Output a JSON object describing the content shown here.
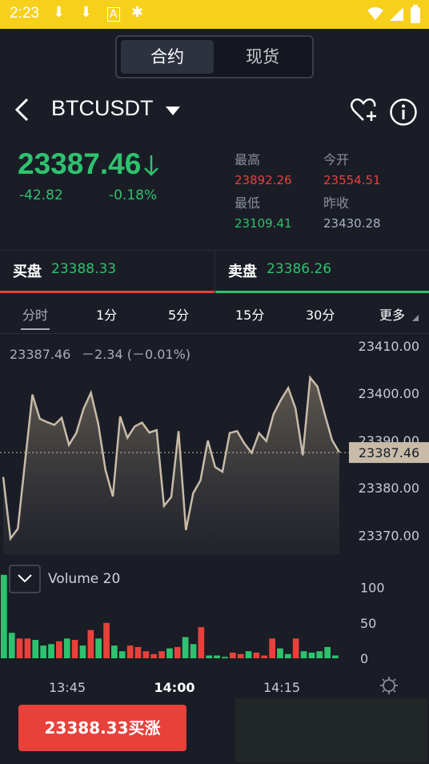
{
  "status": {
    "time": "2:23"
  },
  "segment": {
    "tab_contract": "合约",
    "tab_spot": "现货"
  },
  "header": {
    "symbol": "BTCUSDT"
  },
  "price": {
    "last": "23387.46",
    "change": "-42.82",
    "change_pct": "-0.18%",
    "high_label": "最高",
    "high": "23892.26",
    "open_label": "今开",
    "open": "23554.51",
    "low_label": "最低",
    "low": "23109.41",
    "prev_label": "昨收",
    "prev": "23430.28"
  },
  "bidask": {
    "bid_label": "买盘",
    "bid": "23388.33",
    "ask_label": "卖盘",
    "ask": "23386.26"
  },
  "tabs": [
    "分时",
    "1分",
    "5分",
    "15分",
    "30分",
    "更多"
  ],
  "chart_data": {
    "type": "line",
    "info_price": "23387.46",
    "info_change": "－2.34 (－0.01%)",
    "y_ticks": [
      "23410.00",
      "23400.00",
      "23390.00",
      "23380.00",
      "23370.00"
    ],
    "ylim": [
      23366,
      23411
    ],
    "current_price": 23387.46,
    "current_label": "23387.46",
    "values": [
      23382.3,
      23369.3,
      23371.4,
      23385.7,
      23399.7,
      23394.6,
      23393.9,
      23393.3,
      23394.8,
      23389.1,
      23391.6,
      23396.7,
      23400.1,
      23393.6,
      23383.8,
      23378.2,
      23395.1,
      23390.6,
      23393.0,
      23393.8,
      23391.7,
      23392.2,
      23376.2,
      23378.1,
      23392.0,
      23371.1,
      23378.9,
      23381.6,
      23390.0,
      23384.4,
      23383.4,
      23391.6,
      23392.0,
      23389.4,
      23387.4,
      23391.6,
      23389.9,
      23395.6,
      23398.6,
      23401.1,
      23396.8,
      23386.9,
      23403.3,
      23401.4,
      23395.6,
      23390.1,
      23387.5
    ],
    "volume": {
      "label": "Volume 20",
      "y_ticks": [
        "100",
        "50",
        "0"
      ],
      "ylim": [
        0,
        120
      ],
      "values": [
        118,
        36,
        28,
        28,
        26,
        18,
        20,
        24,
        28,
        26,
        18,
        40,
        28,
        50,
        18,
        10,
        18,
        16,
        10,
        6,
        10,
        14,
        16,
        30,
        20,
        44,
        4,
        4,
        2,
        8,
        6,
        10,
        8,
        4,
        28,
        14,
        6,
        28,
        10,
        8,
        10,
        16,
        4
      ],
      "up": [
        1,
        1,
        0,
        0,
        1,
        1,
        1,
        0,
        1,
        0,
        1,
        0,
        1,
        0,
        1,
        1,
        0,
        0,
        0,
        0,
        0,
        1,
        0,
        1,
        1,
        0,
        1,
        1,
        1,
        0,
        0,
        1,
        0,
        0,
        0,
        1,
        1,
        0,
        1,
        1,
        1,
        1,
        1
      ]
    },
    "x_ticks": [
      "13:45",
      "14:00",
      "14:15"
    ]
  },
  "bottom": {
    "buy_label": "23388.33买涨"
  },
  "colors": {
    "up": "#2ec26e",
    "down": "#e8413b",
    "line": "#c8bba8",
    "bg": "#1a1d26"
  },
  "icons": [
    "download-icon",
    "download-icon",
    "android-icon",
    "bug-icon",
    "wifi-icon",
    "signal-icon",
    "battery-icon",
    "back-icon",
    "dropdown-icon",
    "favorite-add-icon",
    "info-icon",
    "settings-icon"
  ]
}
